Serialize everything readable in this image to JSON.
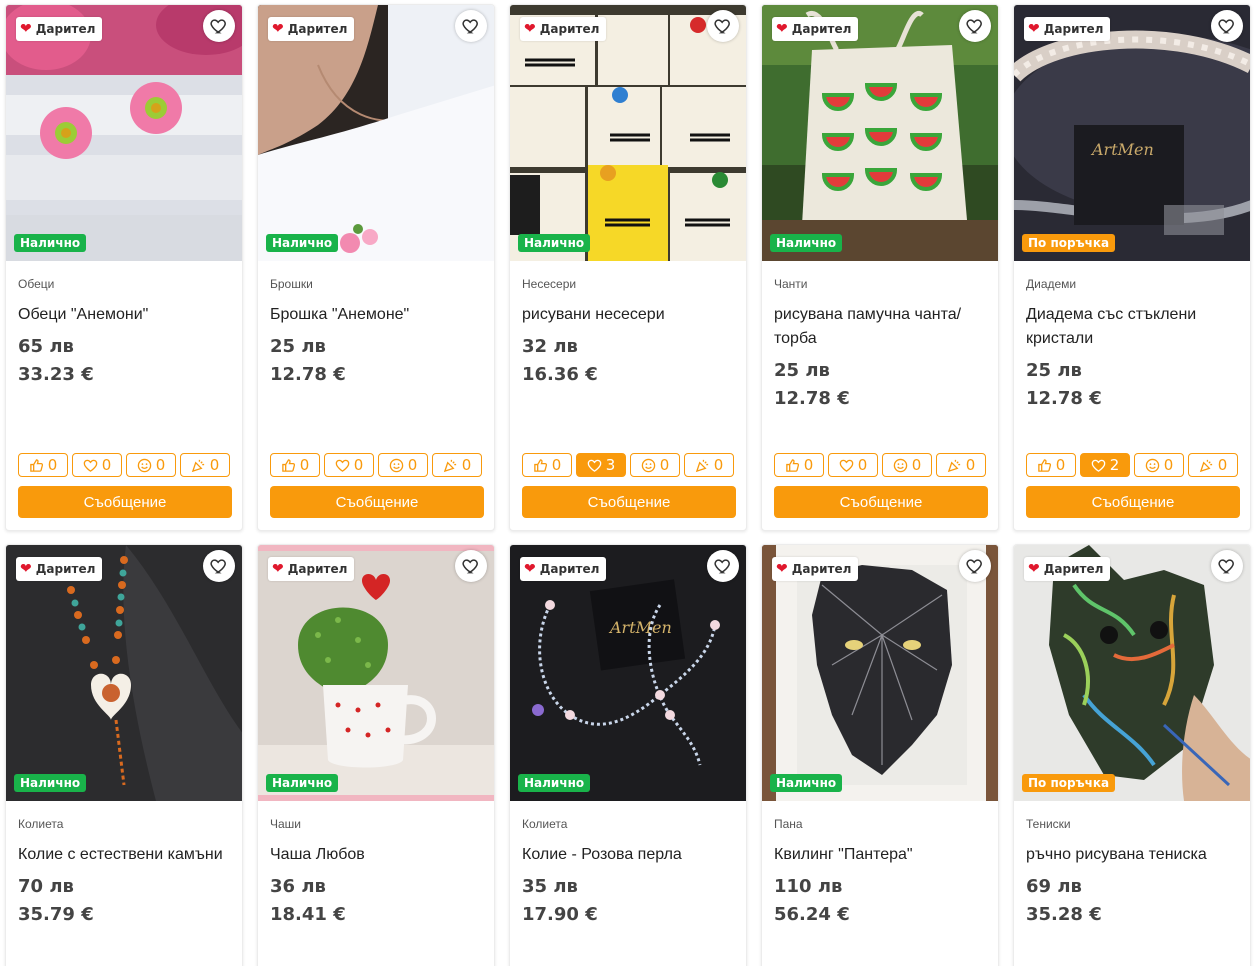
{
  "labels": {
    "donor": "Дарител",
    "message": "Съобщение",
    "currency_bgn": "лв",
    "currency_eur": "€"
  },
  "products": [
    {
      "category": "Обеци",
      "title": "Обеци \"Анемони\"",
      "price_bgn": "65 лв",
      "price_eur": "33.23 €",
      "availability": "Налично",
      "availability_type": "green",
      "reactions": {
        "like": "0",
        "love": "0",
        "smile": "0",
        "celebrate": "0"
      },
      "love_active": false,
      "image": "pink-flower-earrings"
    },
    {
      "category": "Брошки",
      "title": "Брошка \"Анемоне\"",
      "price_bgn": "25 лв",
      "price_eur": "12.78 €",
      "availability": "Налично",
      "availability_type": "green",
      "reactions": {
        "like": "0",
        "love": "0",
        "smile": "0",
        "celebrate": "0"
      },
      "love_active": false,
      "image": "white-shirt-brooch"
    },
    {
      "category": "Несесери",
      "title": "рисувани несесери",
      "price_bgn": "32 лв",
      "price_eur": "16.36 €",
      "availability": "Налично",
      "availability_type": "green",
      "reactions": {
        "like": "0",
        "love": "3",
        "smile": "0",
        "celebrate": "0"
      },
      "love_active": true,
      "image": "dachshund-pouches"
    },
    {
      "category": "Чанти",
      "title": "рисувана памучна чанта/ торба",
      "price_bgn": "25 лв",
      "price_eur": "12.78 €",
      "availability": "Налично",
      "availability_type": "green",
      "reactions": {
        "like": "0",
        "love": "0",
        "smile": "0",
        "celebrate": "0"
      },
      "love_active": false,
      "image": "watermelon-tote"
    },
    {
      "category": "Диадеми",
      "title": "Диадема със стъклени кристали",
      "price_bgn": "25 лв",
      "price_eur": "12.78 €",
      "availability": "По поръчка",
      "availability_type": "orange",
      "reactions": {
        "like": "0",
        "love": "2",
        "smile": "0",
        "celebrate": "0"
      },
      "love_active": true,
      "image": "crystal-headband"
    },
    {
      "category": "Колиета",
      "title": "Колие с естествени камъни",
      "price_bgn": "70 лв",
      "price_eur": "35.79 €",
      "availability": "Налично",
      "availability_type": "green",
      "reactions": null,
      "love_active": false,
      "image": "stone-necklace"
    },
    {
      "category": "Чаши",
      "title": "Чаша Любов",
      "price_bgn": "36 лв",
      "price_eur": "18.41 €",
      "availability": "Налично",
      "availability_type": "green",
      "reactions": null,
      "love_active": false,
      "image": "cactus-heart-cup"
    },
    {
      "category": "Колиета",
      "title": "Колие - Розова перла",
      "price_bgn": "35 лв",
      "price_eur": "17.90 €",
      "availability": "Налично",
      "availability_type": "green",
      "reactions": null,
      "love_active": false,
      "image": "pearl-bead-necklace"
    },
    {
      "category": "Пана",
      "title": "Квилинг \"Пантера\"",
      "price_bgn": "110 лв",
      "price_eur": "56.24 €",
      "availability": "Налично",
      "availability_type": "green",
      "reactions": null,
      "love_active": false,
      "image": "quilling-panther"
    },
    {
      "category": "Тениски",
      "title": "ръчно рисувана тениска",
      "price_bgn": "69 лв",
      "price_eur": "35.28 €",
      "availability": "По поръчка",
      "availability_type": "orange",
      "reactions": null,
      "love_active": false,
      "image": "painted-bulldog-tshirt"
    }
  ],
  "colors": {
    "accent": "#f99a0c",
    "available": "#19b34a",
    "donor_heart": "#e0182d"
  }
}
